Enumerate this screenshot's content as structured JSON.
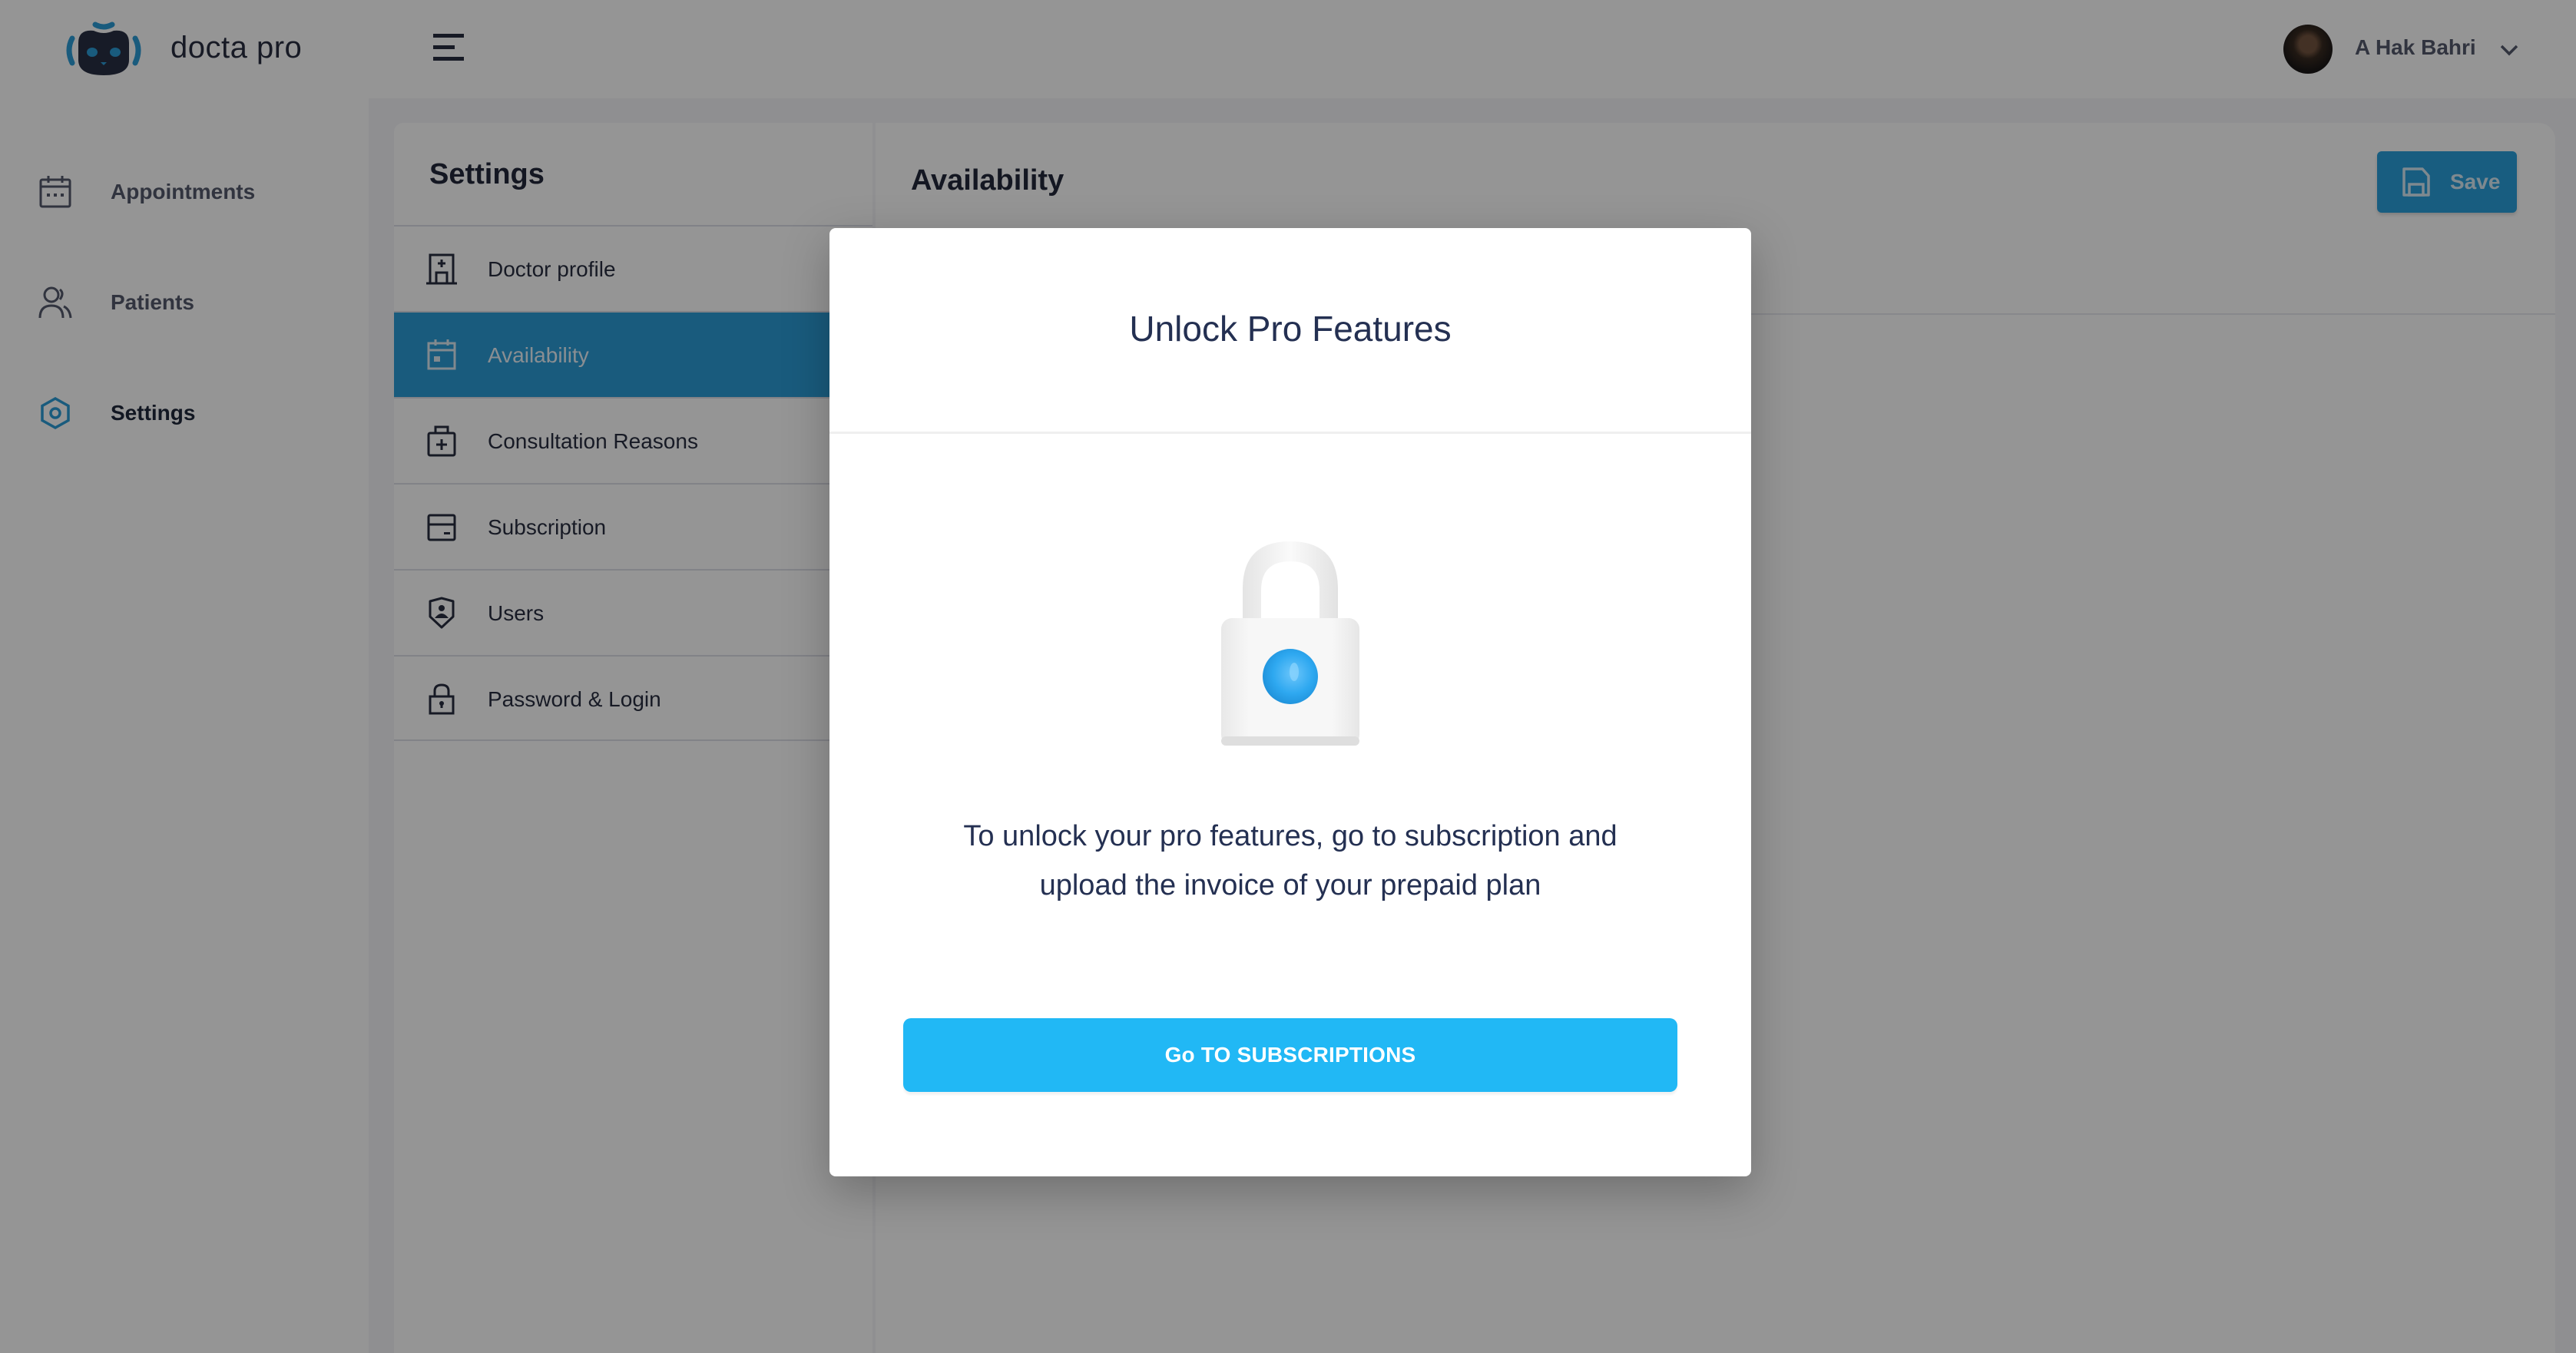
{
  "app": {
    "brand": "docta pro",
    "user": {
      "name": "A Hak Bahri"
    }
  },
  "sidenav": {
    "items": [
      {
        "label": "Appointments",
        "icon": "calendar-icon",
        "active": false
      },
      {
        "label": "Patients",
        "icon": "users-icon",
        "active": false
      },
      {
        "label": "Settings",
        "icon": "settings-hexagon-icon",
        "active": true
      }
    ]
  },
  "settings": {
    "title": "Settings",
    "items": [
      {
        "label": "Doctor profile",
        "icon": "hospital-icon",
        "active": false
      },
      {
        "label": "Availability",
        "icon": "calendar-icon",
        "active": true
      },
      {
        "label": "Consultation Reasons",
        "icon": "medical-kit-icon",
        "active": false
      },
      {
        "label": "Subscription",
        "icon": "card-icon",
        "active": false
      },
      {
        "label": "Users",
        "icon": "user-shield-icon",
        "active": false
      },
      {
        "label": "Password & Login",
        "icon": "padlock-icon",
        "active": false
      }
    ]
  },
  "content": {
    "title": "Availability",
    "save_label": "Save"
  },
  "modal": {
    "title": "Unlock Pro Features",
    "message": "To unlock your pro features, go to subscription and upload the invoice of your prepaid plan",
    "cta_label": "Go TO SUBSCRIPTIONS"
  },
  "colors": {
    "accent": "#1e95d4",
    "cta": "#21b8f5",
    "text_dark": "#1a2033"
  }
}
